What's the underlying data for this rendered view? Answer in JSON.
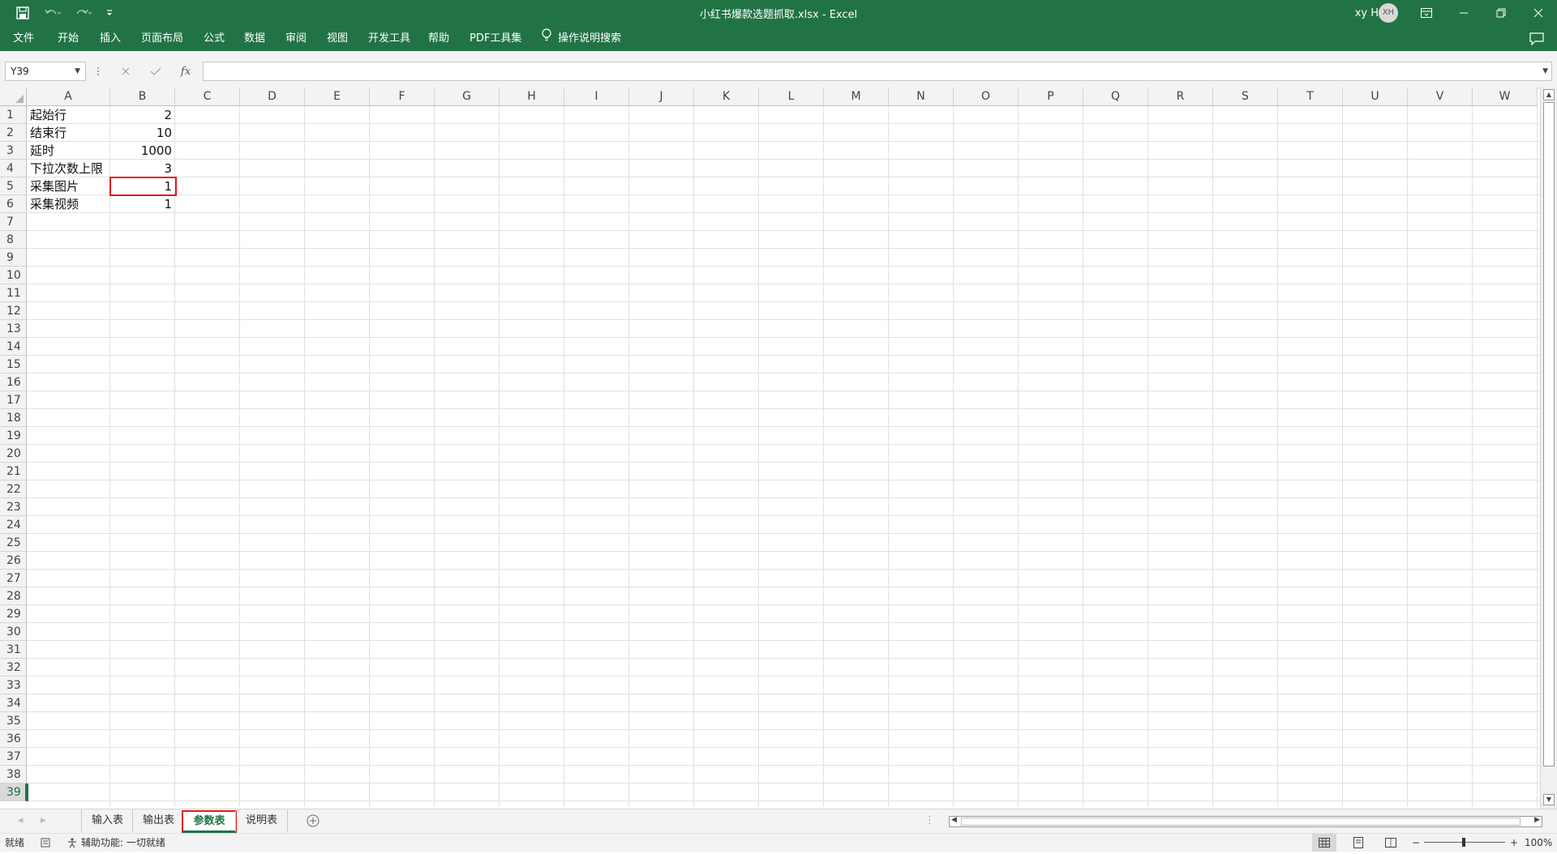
{
  "window": {
    "title": "小红书爆款选题抓取.xlsx  -  Excel",
    "user_name": "xy H",
    "avatar_initials": "XH"
  },
  "ribbon": {
    "tabs": [
      "文件",
      "开始",
      "插入",
      "页面布局",
      "公式",
      "数据",
      "审阅",
      "视图",
      "开发工具",
      "帮助",
      "PDF工具集"
    ],
    "tell_me": "操作说明搜索"
  },
  "formula_bar": {
    "name_box": "Y39",
    "fx_label": "fx",
    "formula": ""
  },
  "sheet": {
    "columns": [
      "A",
      "B",
      "C",
      "D",
      "E",
      "F",
      "G",
      "H",
      "I",
      "J",
      "K",
      "L",
      "M",
      "N",
      "O",
      "P",
      "Q",
      "R",
      "S",
      "T",
      "U",
      "V",
      "W"
    ],
    "row_numbers": [
      "1",
      "2",
      "3",
      "4",
      "5",
      "6",
      "7",
      "8",
      "9",
      "10",
      "11",
      "12",
      "13",
      "14",
      "15",
      "16",
      "17",
      "18",
      "19",
      "20",
      "21",
      "22",
      "23",
      "24",
      "25",
      "26",
      "27",
      "28",
      "29",
      "30",
      "31",
      "32",
      "33",
      "34",
      "35",
      "36",
      "37",
      "38",
      "39"
    ],
    "rows": [
      {
        "label": "起始行",
        "value": "2"
      },
      {
        "label": "结束行",
        "value": "10"
      },
      {
        "label": "延时",
        "value": "1000"
      },
      {
        "label": "下拉次数上限",
        "value": "3"
      },
      {
        "label": "采集图片",
        "value": "1"
      },
      {
        "label": "采集视频",
        "value": "1"
      }
    ]
  },
  "sheet_tabs": [
    "输入表",
    "输出表",
    "参数表",
    "说明表"
  ],
  "active_sheet": "参数表",
  "statusbar": {
    "ready": "就绪",
    "accessibility": "辅助功能: 一切就绪",
    "zoom": "100%",
    "zoom_minus": "−",
    "zoom_plus": "+"
  },
  "colors": {
    "brand": "#217346",
    "highlight": "#e01b1b"
  }
}
